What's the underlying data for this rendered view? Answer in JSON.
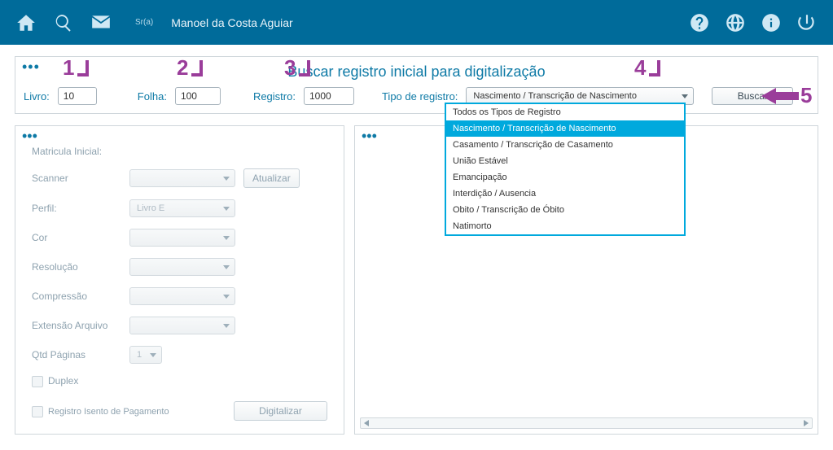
{
  "header": {
    "user_prefix": "Sr(a)",
    "user_name": "Manoel da Costa Aguiar"
  },
  "search": {
    "title": "Buscar registro inicial para digitalização",
    "livro_label": "Livro:",
    "livro_value": "10",
    "folha_label": "Folha:",
    "folha_value": "100",
    "registro_label": "Registro:",
    "registro_value": "1000",
    "tipo_label": "Tipo de registro:",
    "tipo_selected": "Nascimento / Transcrição de Nascimento",
    "buscar_label": "Buscar",
    "tipo_options": [
      "Todos os Tipos de Registro",
      "Nascimento / Transcrição de Nascimento",
      "Casamento / Transcrição de Casamento",
      "União Estável",
      "Emancipação",
      "Interdição / Ausencia",
      "Obito / Transcrição de Óbito",
      "Natimorto"
    ]
  },
  "annotations": {
    "n1": "1",
    "n2": "2",
    "n3": "3",
    "n4": "4",
    "n5": "5"
  },
  "leftPanel": {
    "matricula_label": "Matricula Inicial:",
    "scanner_label": "Scanner",
    "atualizar_label": "Atualizar",
    "perfil_label": "Perfil:",
    "perfil_value": "Livro E",
    "cor_label": "Cor",
    "resolucao_label": "Resolução",
    "compressao_label": "Compressão",
    "extensao_label": "Extensão Arquivo",
    "qtd_label": "Qtd Páginas",
    "qtd_value": "1",
    "duplex_label": "Duplex",
    "isento_label": "Registro Isento de Pagamento",
    "digitalizar_label": "Digitalizar"
  }
}
